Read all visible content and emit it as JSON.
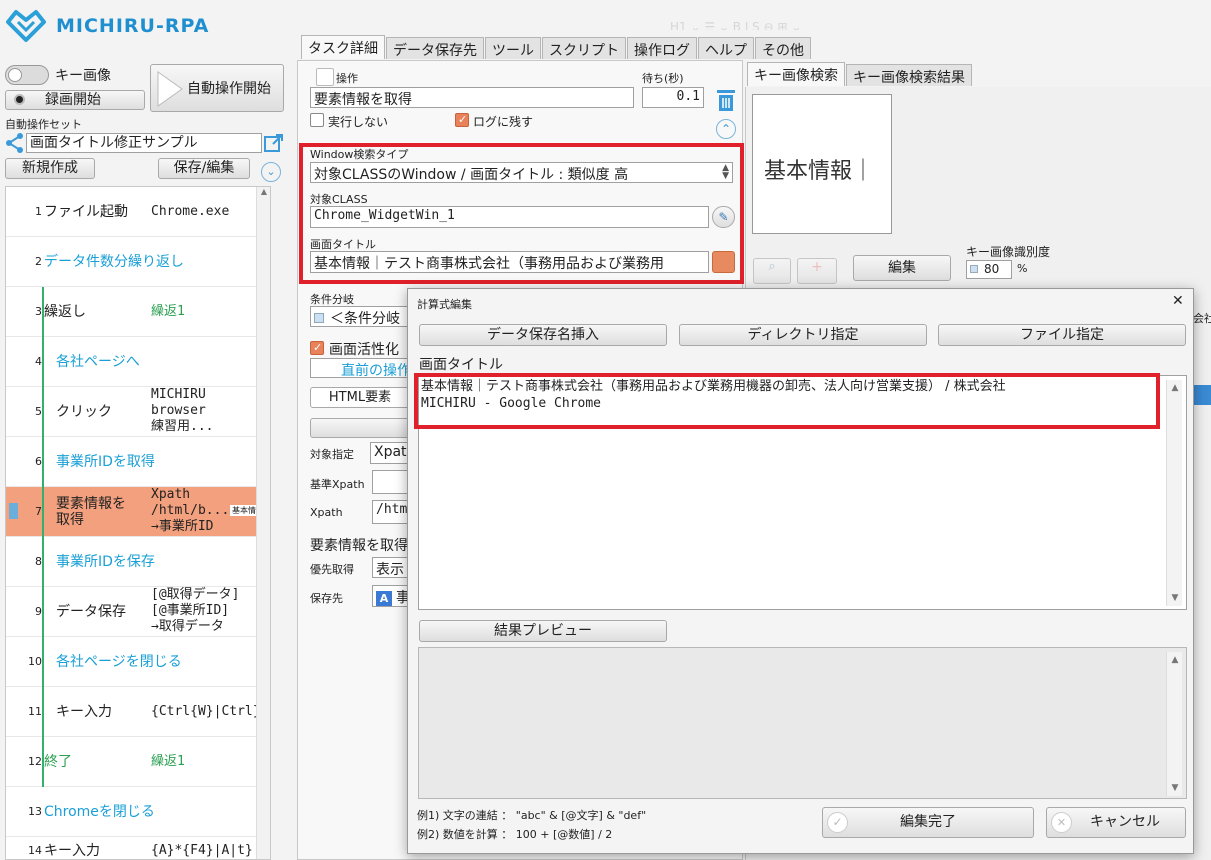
{
  "logo": {
    "name": "MICHIRU-RPA"
  },
  "ghost_toolbar": {
    "text": "H1 ⌄   ☰ ⌄   B  I  S  ⊖  ⊞ ⌄"
  },
  "left_panel": {
    "key_image_toggle": "キー画像",
    "record_label": "録画開始",
    "auto_start": "自動操作開始",
    "set_label": "自動操作セット",
    "set_name": "画面タイトル修正サンプル",
    "new_button": "新規作成",
    "save_button": "保存/編集"
  },
  "tasks": [
    {
      "num": "1",
      "name": "ファイル起動",
      "param": "Chrome.exe"
    },
    {
      "num": "2",
      "name": "データ件数分繰り返し",
      "param": ""
    },
    {
      "num": "3",
      "name": "繰返し",
      "param": "繰返1"
    },
    {
      "num": "4",
      "name": "各社ページへ",
      "param": ""
    },
    {
      "num": "5",
      "name": "クリック",
      "param_lines": [
        "MICHIRU",
        "browser",
        "練習用..."
      ]
    },
    {
      "num": "6",
      "name": "事業所IDを取得",
      "param": ""
    },
    {
      "num": "7",
      "name_lines": [
        "要素情報を",
        "取得"
      ],
      "param_lines": [
        "Xpath",
        "/html/b...",
        "→事業所ID"
      ],
      "thumb": "基本情報｜"
    },
    {
      "num": "8",
      "name": "事業所IDを保存",
      "param": ""
    },
    {
      "num": "9",
      "name": "データ保存",
      "param_lines": [
        "[@取得データ]",
        "[@事業所ID]",
        "→取得データ"
      ]
    },
    {
      "num": "10",
      "name": "各社ページを閉じる",
      "param": ""
    },
    {
      "num": "11",
      "name": "キー入力",
      "param": "{Ctrl{W}|Ctrl}"
    },
    {
      "num": "12",
      "name": "終了",
      "param": "繰返1"
    },
    {
      "num": "13",
      "name": "Chromeを閉じる",
      "param": ""
    },
    {
      "num": "14",
      "name": "キー入力",
      "param": "{A}*{F4}|A|t}"
    }
  ],
  "main_tabs": [
    "タスク詳細",
    "データ保存先",
    "ツール",
    "スクリプト",
    "操作ログ",
    "ヘルプ",
    "その他"
  ],
  "task_detail": {
    "operation_label": "操作",
    "wait_label": "待ち(秒)",
    "operation_value": "要素情報を取得",
    "wait_value": "0.1",
    "no_exec_label": "実行しない",
    "log_label": "ログに残す",
    "window_search_label": "Window検索タイプ",
    "window_search_value": "対象CLASSのWindow / 画面タイトル : 類似度 高",
    "target_class_label": "対象CLASS",
    "target_class_value": "Chrome_WidgetWin_1",
    "screen_title_label": "画面タイトル",
    "screen_title_value": "基本情報｜テスト商事株式会社（事務用品および業務用",
    "condition_label": "条件分岐",
    "condition_value": "＜条件分岐",
    "activate_label": "画面活性化",
    "prev_op_label": "直前の操作",
    "html_elem_label": "HTML要素",
    "target_spec_label": "対象指定",
    "target_spec_value": "Xpat",
    "base_xpath_label": "基準Xpath",
    "xpath_label": "Xpath",
    "xpath_value": "/htm",
    "elem_info_label": "要素情報を取得",
    "priority_label": "優先取得",
    "priority_value": "表示",
    "save_to_label": "保存先",
    "save_to_value": "事"
  },
  "key_image": {
    "tabs": [
      "キー画像検索",
      "キー画像検索結果"
    ],
    "preview_text": "基本情報｜",
    "edit_button": "編集",
    "accuracy_label": "キー画像識別度",
    "accuracy_value": "80",
    "accuracy_unit": "%",
    "ghost_text": "会社"
  },
  "dialog": {
    "title": "計算式編集",
    "close": "✕",
    "btn_insert_data": "データ保存名挿入",
    "btn_directory": "ディレクトリ指定",
    "btn_file": "ファイル指定",
    "field_label": "画面タイトル",
    "formula_line1": "基本情報｜テスト商事株式会社（事務用品および業務用機器の卸売、法人向け営業支援） / 株式会社",
    "formula_line2": "MICHIRU - Google Chrome",
    "preview_button": "結果プレビュー",
    "example1": "例1) 文字の連結 ： \"abc\" & [@文字] & \"def\"",
    "example2": "例2) 数値を計算 ： 100 + [@数値] / 2",
    "ok_button": "編集完了",
    "cancel_button": "キャンセル"
  }
}
